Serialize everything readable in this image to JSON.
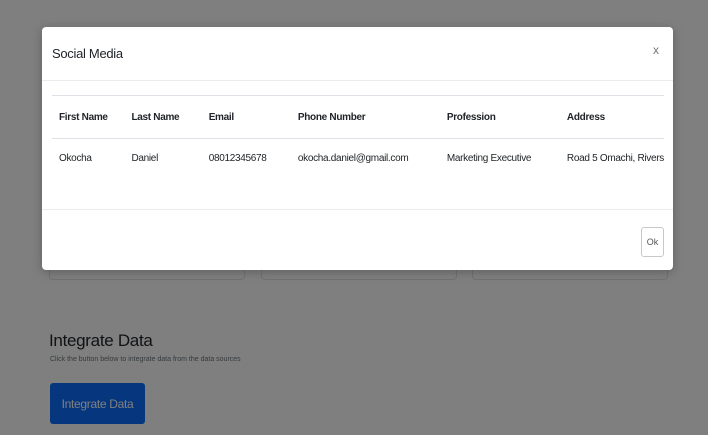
{
  "background": {
    "integrate_section": {
      "title": "Integrate Data",
      "description": "Click the button below to integrate data from the data sources",
      "button_label": "Integrate Data"
    }
  },
  "modal": {
    "title": "Social Media",
    "close_label": "x",
    "table": {
      "columns": [
        "First Name",
        "Last Name",
        "Email",
        "Phone Number",
        "Profession",
        "Address"
      ],
      "rows": [
        [
          "Okocha",
          "Daniel",
          "08012345678",
          "okocha.daniel@gmail.com",
          "Marketing Executive",
          "Road 5 Omachi, Rivers"
        ]
      ]
    },
    "ok_label": "Ok"
  },
  "colors": {
    "primary_button": "#0d6efd",
    "backdrop": "rgba(0,0,0,0.5)"
  }
}
